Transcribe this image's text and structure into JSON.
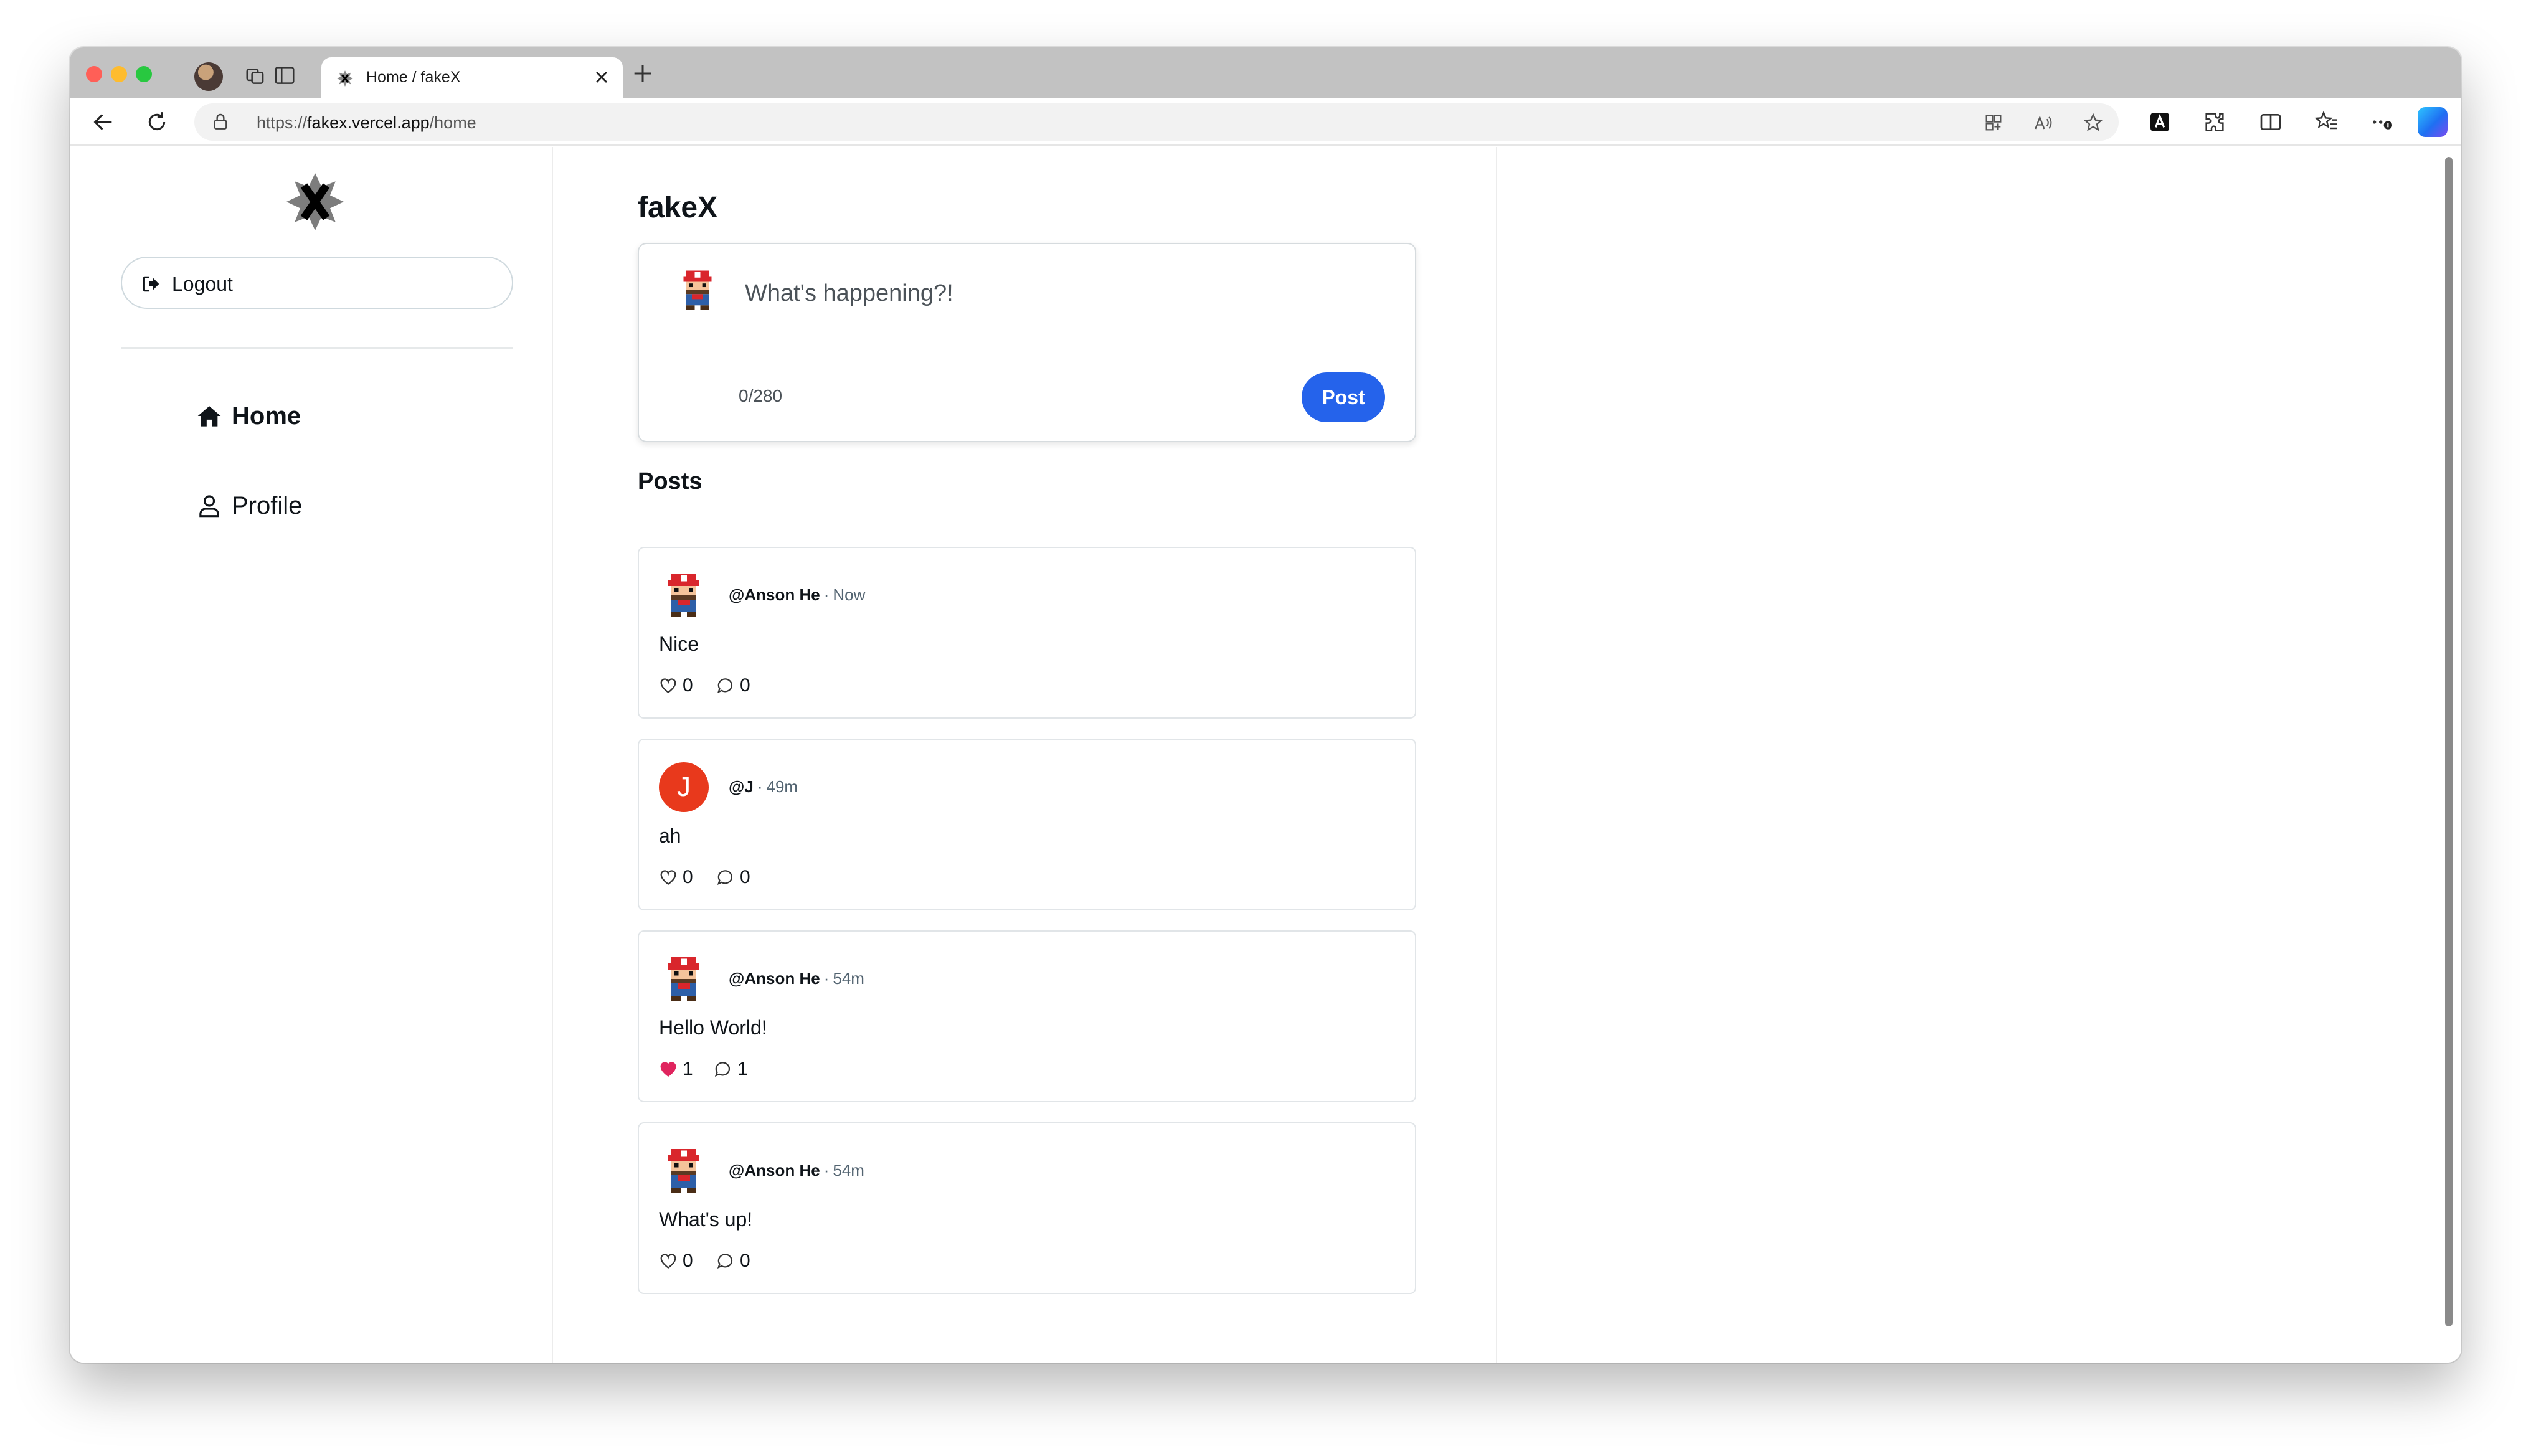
{
  "browser": {
    "tab_title": "Home / fakeX",
    "url_scheme": "https://",
    "url_host": "fakex.vercel.app",
    "url_path": "/home"
  },
  "sidebar": {
    "logout_label": "Logout",
    "items": [
      {
        "label": "Home",
        "icon": "home-icon",
        "active": true
      },
      {
        "label": "Profile",
        "icon": "user-icon",
        "active": false
      }
    ]
  },
  "main": {
    "title": "fakeX",
    "composer": {
      "placeholder": "What's happening?!",
      "char_count": "0/280",
      "post_label": "Post"
    },
    "posts_heading": "Posts",
    "posts": [
      {
        "author": "@Anson He",
        "separator": "·",
        "time": "Now",
        "text": "Nice",
        "likes": "0",
        "comments": "0",
        "liked": false,
        "avatar": "pixel-avatar"
      },
      {
        "author": "@J",
        "separator": "·",
        "time": "49m",
        "text": "ah",
        "likes": "0",
        "comments": "0",
        "liked": false,
        "avatar_letter": "J"
      },
      {
        "author": "@Anson He",
        "separator": "·",
        "time": "54m",
        "text": "Hello World!",
        "likes": "1",
        "comments": "1",
        "liked": true,
        "avatar": "pixel-avatar"
      },
      {
        "author": "@Anson He",
        "separator": "·",
        "time": "54m",
        "text": "What's up!",
        "likes": "0",
        "comments": "0",
        "liked": false,
        "avatar": "pixel-avatar"
      }
    ]
  },
  "colors": {
    "accent": "#2563eb",
    "like_red": "#e0245e",
    "letter_avatar": "#e8391c"
  }
}
